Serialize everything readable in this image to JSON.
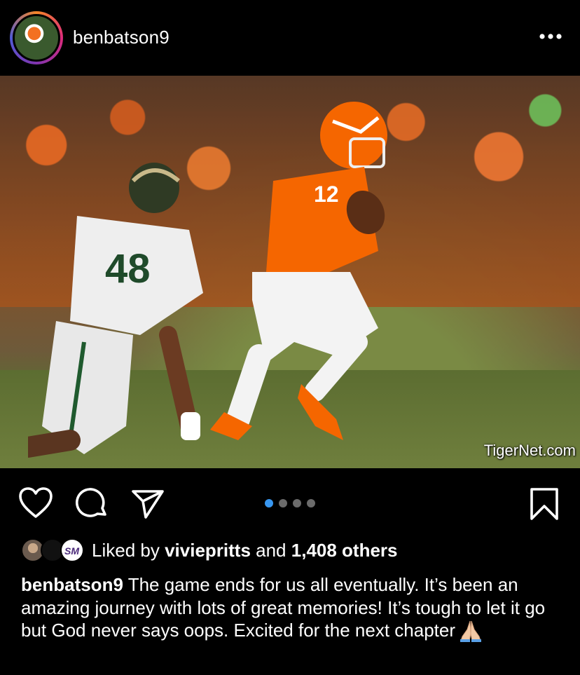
{
  "post": {
    "username": "benbatson9",
    "more_icon": "ellipsis-icon",
    "photo": {
      "watermark": "TigerNet.com",
      "jersey_white": "48",
      "jersey_orange": "12"
    },
    "carousel": {
      "count": 4,
      "active_index": 0
    },
    "likes": {
      "prefix": "Liked by",
      "user": "viviepritts",
      "and": "and",
      "others": "1,408 others"
    },
    "caption": {
      "username": "benbatson9",
      "text": "The game ends for us all eventually. It’s been an amazing journey with lots of great memories! It’s tough to let it go but God never says oops. Excited for the next chapter"
    }
  },
  "colors": {
    "background": "#000000",
    "text": "#ffffff",
    "carousel_active": "#3897f0",
    "carousel_inactive": "#6b6b6b",
    "clemson_orange": "#f56600"
  }
}
